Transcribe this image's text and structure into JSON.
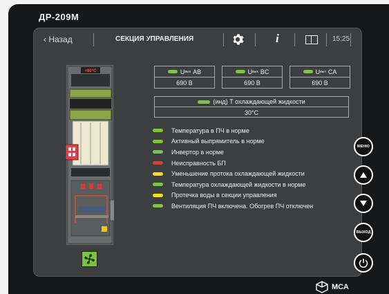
{
  "device": {
    "model": "ДР-209М",
    "logo_text": "МСА"
  },
  "topbar": {
    "back_label": "Назад",
    "title": "СЕКЦИЯ УПРАВЛЕНИЯ",
    "info_label": "i",
    "clock": "15:25"
  },
  "cabinet": {
    "temp_badge": "+80°С"
  },
  "voltages": [
    {
      "label_main": "U",
      "label_sub": "вых",
      "label_phase": "AB",
      "value": "690 В",
      "color": "#7ec540"
    },
    {
      "label_main": "U",
      "label_sub": "вых",
      "label_phase": "BC",
      "value": "690 В",
      "color": "#7ec540"
    },
    {
      "label_main": "U",
      "label_sub": "вых",
      "label_phase": "CA",
      "value": "690 В",
      "color": "#7ec540"
    }
  ],
  "coolant": {
    "label": "(инд) Т охлаждающей жидкости",
    "value": "30°С",
    "color": "#7ec540"
  },
  "status_items": [
    {
      "text": "Температура в ПЧ в норме",
      "color": "#7ec540"
    },
    {
      "text": "Активный выпрямитель в норме",
      "color": "#7ec540"
    },
    {
      "text": "Инвертор в норме",
      "color": "#7ec540"
    },
    {
      "text": "Неисправность БП",
      "color": "#e83a2a"
    },
    {
      "text": "Уменьшение протока охлаждающей жидкости",
      "color": "#f4e01a"
    },
    {
      "text": "Температура охлаждающей жидкости в норме",
      "color": "#7ec540"
    },
    {
      "text": "Протечка воды в секции управления",
      "color": "#f4e01a"
    },
    {
      "text": "Вентиляция ПЧ включена. Обогрев ПЧ отключен",
      "color": "#7ec540"
    }
  ],
  "side_buttons": {
    "menu": "МЕНЮ",
    "exit": "ВЫХОД"
  },
  "icons": [
    "gear-icon",
    "info-icon",
    "panel-icon",
    "fan-icon",
    "arrow-up-icon",
    "arrow-down-icon",
    "power-icon",
    "mca-logo-icon"
  ]
}
